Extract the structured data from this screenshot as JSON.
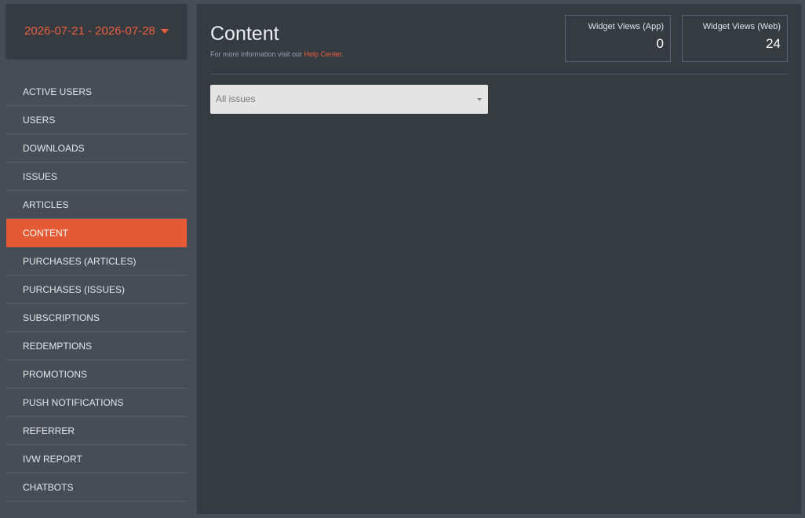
{
  "date_range": {
    "label": "2026-07-21 - 2026-07-28",
    "icon": "caret-down-icon"
  },
  "nav": {
    "items": [
      {
        "label": "ACTIVE USERS",
        "active": false
      },
      {
        "label": "USERS",
        "active": false
      },
      {
        "label": "DOWNLOADS",
        "active": false
      },
      {
        "label": "ISSUES",
        "active": false
      },
      {
        "label": "ARTICLES",
        "active": false
      },
      {
        "label": "CONTENT",
        "active": true
      },
      {
        "label": "PURCHASES (ARTICLES)",
        "active": false
      },
      {
        "label": "PURCHASES (ISSUES)",
        "active": false
      },
      {
        "label": "SUBSCRIPTIONS",
        "active": false
      },
      {
        "label": "REDEMPTIONS",
        "active": false
      },
      {
        "label": "PROMOTIONS",
        "active": false
      },
      {
        "label": "PUSH NOTIFICATIONS",
        "active": false
      },
      {
        "label": "REFERRER",
        "active": false
      },
      {
        "label": "IVW REPORT",
        "active": false
      },
      {
        "label": "CHATBOTS",
        "active": false
      }
    ]
  },
  "header": {
    "title": "Content",
    "help_prefix": "For more information visit our ",
    "help_link": "Help Center",
    "help_suffix": "."
  },
  "stats": [
    {
      "label": "Widget Views (App)",
      "value": "0"
    },
    {
      "label": "Widget Views (Web)",
      "value": "24"
    }
  ],
  "filter": {
    "selected": "All issues"
  },
  "colors": {
    "accent": "#e45a35",
    "sidebar_bg": "#363b42",
    "page_bg": "#474d55"
  }
}
